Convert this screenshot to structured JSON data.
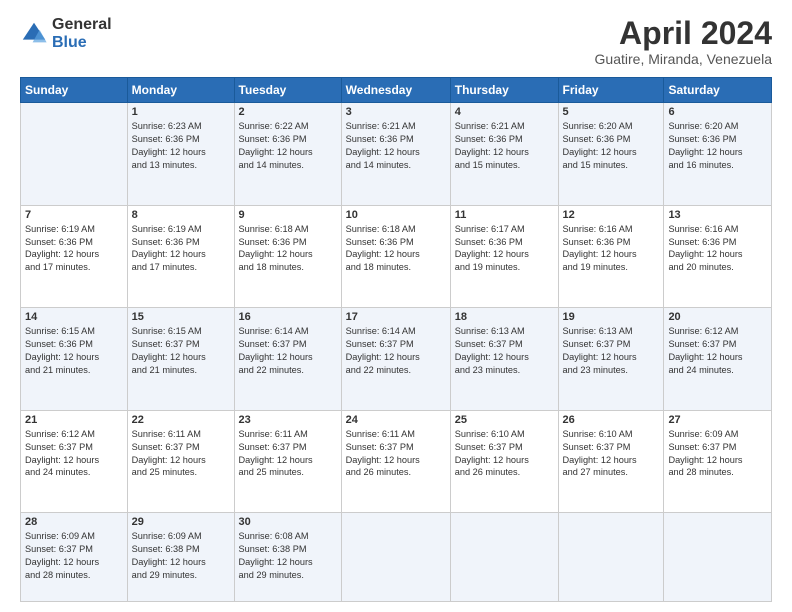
{
  "header": {
    "logo_general": "General",
    "logo_blue": "Blue",
    "month_title": "April 2024",
    "location": "Guatire, Miranda, Venezuela"
  },
  "calendar": {
    "days_of_week": [
      "Sunday",
      "Monday",
      "Tuesday",
      "Wednesday",
      "Thursday",
      "Friday",
      "Saturday"
    ],
    "weeks": [
      [
        {
          "day": "",
          "info": ""
        },
        {
          "day": "1",
          "info": "Sunrise: 6:23 AM\nSunset: 6:36 PM\nDaylight: 12 hours\nand 13 minutes."
        },
        {
          "day": "2",
          "info": "Sunrise: 6:22 AM\nSunset: 6:36 PM\nDaylight: 12 hours\nand 14 minutes."
        },
        {
          "day": "3",
          "info": "Sunrise: 6:21 AM\nSunset: 6:36 PM\nDaylight: 12 hours\nand 14 minutes."
        },
        {
          "day": "4",
          "info": "Sunrise: 6:21 AM\nSunset: 6:36 PM\nDaylight: 12 hours\nand 15 minutes."
        },
        {
          "day": "5",
          "info": "Sunrise: 6:20 AM\nSunset: 6:36 PM\nDaylight: 12 hours\nand 15 minutes."
        },
        {
          "day": "6",
          "info": "Sunrise: 6:20 AM\nSunset: 6:36 PM\nDaylight: 12 hours\nand 16 minutes."
        }
      ],
      [
        {
          "day": "7",
          "info": "Sunrise: 6:19 AM\nSunset: 6:36 PM\nDaylight: 12 hours\nand 17 minutes."
        },
        {
          "day": "8",
          "info": "Sunrise: 6:19 AM\nSunset: 6:36 PM\nDaylight: 12 hours\nand 17 minutes."
        },
        {
          "day": "9",
          "info": "Sunrise: 6:18 AM\nSunset: 6:36 PM\nDaylight: 12 hours\nand 18 minutes."
        },
        {
          "day": "10",
          "info": "Sunrise: 6:18 AM\nSunset: 6:36 PM\nDaylight: 12 hours\nand 18 minutes."
        },
        {
          "day": "11",
          "info": "Sunrise: 6:17 AM\nSunset: 6:36 PM\nDaylight: 12 hours\nand 19 minutes."
        },
        {
          "day": "12",
          "info": "Sunrise: 6:16 AM\nSunset: 6:36 PM\nDaylight: 12 hours\nand 19 minutes."
        },
        {
          "day": "13",
          "info": "Sunrise: 6:16 AM\nSunset: 6:36 PM\nDaylight: 12 hours\nand 20 minutes."
        }
      ],
      [
        {
          "day": "14",
          "info": "Sunrise: 6:15 AM\nSunset: 6:36 PM\nDaylight: 12 hours\nand 21 minutes."
        },
        {
          "day": "15",
          "info": "Sunrise: 6:15 AM\nSunset: 6:37 PM\nDaylight: 12 hours\nand 21 minutes."
        },
        {
          "day": "16",
          "info": "Sunrise: 6:14 AM\nSunset: 6:37 PM\nDaylight: 12 hours\nand 22 minutes."
        },
        {
          "day": "17",
          "info": "Sunrise: 6:14 AM\nSunset: 6:37 PM\nDaylight: 12 hours\nand 22 minutes."
        },
        {
          "day": "18",
          "info": "Sunrise: 6:13 AM\nSunset: 6:37 PM\nDaylight: 12 hours\nand 23 minutes."
        },
        {
          "day": "19",
          "info": "Sunrise: 6:13 AM\nSunset: 6:37 PM\nDaylight: 12 hours\nand 23 minutes."
        },
        {
          "day": "20",
          "info": "Sunrise: 6:12 AM\nSunset: 6:37 PM\nDaylight: 12 hours\nand 24 minutes."
        }
      ],
      [
        {
          "day": "21",
          "info": "Sunrise: 6:12 AM\nSunset: 6:37 PM\nDaylight: 12 hours\nand 24 minutes."
        },
        {
          "day": "22",
          "info": "Sunrise: 6:11 AM\nSunset: 6:37 PM\nDaylight: 12 hours\nand 25 minutes."
        },
        {
          "day": "23",
          "info": "Sunrise: 6:11 AM\nSunset: 6:37 PM\nDaylight: 12 hours\nand 25 minutes."
        },
        {
          "day": "24",
          "info": "Sunrise: 6:11 AM\nSunset: 6:37 PM\nDaylight: 12 hours\nand 26 minutes."
        },
        {
          "day": "25",
          "info": "Sunrise: 6:10 AM\nSunset: 6:37 PM\nDaylight: 12 hours\nand 26 minutes."
        },
        {
          "day": "26",
          "info": "Sunrise: 6:10 AM\nSunset: 6:37 PM\nDaylight: 12 hours\nand 27 minutes."
        },
        {
          "day": "27",
          "info": "Sunrise: 6:09 AM\nSunset: 6:37 PM\nDaylight: 12 hours\nand 28 minutes."
        }
      ],
      [
        {
          "day": "28",
          "info": "Sunrise: 6:09 AM\nSunset: 6:37 PM\nDaylight: 12 hours\nand 28 minutes."
        },
        {
          "day": "29",
          "info": "Sunrise: 6:09 AM\nSunset: 6:38 PM\nDaylight: 12 hours\nand 29 minutes."
        },
        {
          "day": "30",
          "info": "Sunrise: 6:08 AM\nSunset: 6:38 PM\nDaylight: 12 hours\nand 29 minutes."
        },
        {
          "day": "",
          "info": ""
        },
        {
          "day": "",
          "info": ""
        },
        {
          "day": "",
          "info": ""
        },
        {
          "day": "",
          "info": ""
        }
      ]
    ]
  }
}
